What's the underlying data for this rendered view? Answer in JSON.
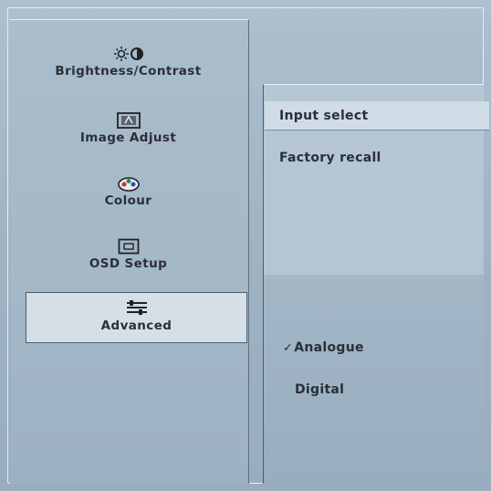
{
  "menu": {
    "items": [
      {
        "id": "brightness",
        "label": "Brightness/Contrast",
        "icon": "brightness-contrast-icon"
      },
      {
        "id": "image",
        "label": "Image Adjust",
        "icon": "image-adjust-icon"
      },
      {
        "id": "colour",
        "label": "Colour",
        "icon": "colour-palette-icon"
      },
      {
        "id": "osd",
        "label": "OSD Setup",
        "icon": "osd-setup-icon"
      },
      {
        "id": "advanced",
        "label": "Advanced",
        "icon": "advanced-settings-icon",
        "selected": true
      }
    ]
  },
  "submenu": {
    "items": [
      {
        "label": "Input select",
        "highlighted": true
      },
      {
        "label": "Factory recall"
      }
    ]
  },
  "input_options": {
    "items": [
      {
        "label": "Analogue",
        "checked": true
      },
      {
        "label": "Digital",
        "checked": false
      }
    ],
    "check_mark": "✓"
  },
  "colors": {
    "background": "#a6b9c9",
    "selected_fill": "#d4dfe7",
    "text": "#2c2f36"
  }
}
